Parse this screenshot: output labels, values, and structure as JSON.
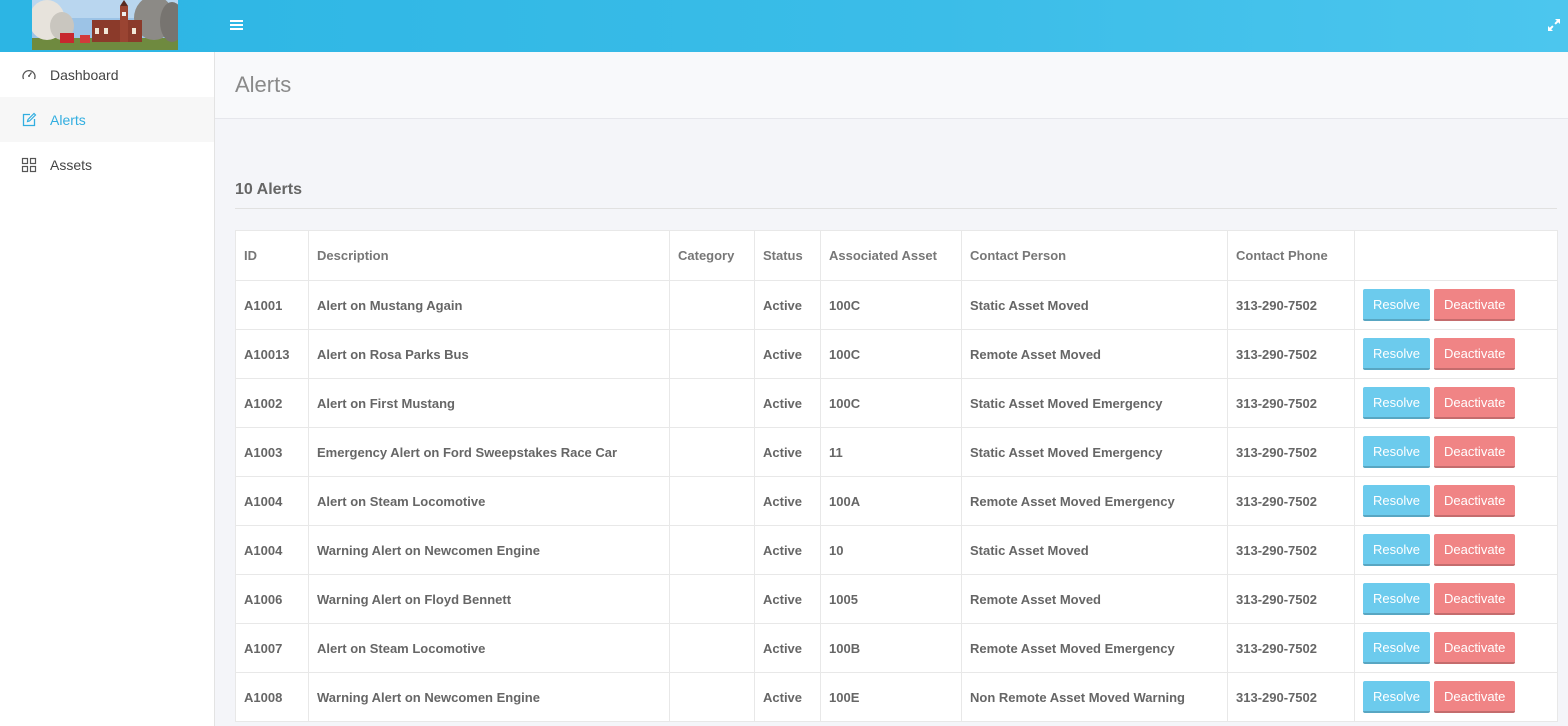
{
  "header": {
    "logo_alt": "Greenfield Village clock tower",
    "menu_icon": "hamburger-icon",
    "expand_icon": "expand-icon"
  },
  "sidebar": {
    "items": [
      {
        "label": "Dashboard",
        "icon": "gauge-icon"
      },
      {
        "label": "Alerts",
        "icon": "edit-icon",
        "active": true
      },
      {
        "label": "Assets",
        "icon": "grid-icon"
      }
    ]
  },
  "page": {
    "title": "Alerts",
    "section_title": "10 Alerts"
  },
  "table": {
    "columns": [
      "ID",
      "Description",
      "Category",
      "Status",
      "Associated Asset",
      "Contact Person",
      "Contact Phone",
      ""
    ],
    "resolve_label": "Resolve",
    "deactivate_label": "Deactivate",
    "rows": [
      {
        "id": "A1001",
        "description": "Alert on Mustang Again",
        "category": "",
        "status": "Active",
        "asset": "100C",
        "contact": "Static Asset Moved",
        "phone": "313-290-7502"
      },
      {
        "id": "A10013",
        "description": "Alert on Rosa Parks Bus",
        "category": "",
        "status": "Active",
        "asset": "100C",
        "contact": "Remote Asset Moved",
        "phone": "313-290-7502"
      },
      {
        "id": "A1002",
        "description": "Alert on First Mustang",
        "category": "",
        "status": "Active",
        "asset": "100C",
        "contact": "Static Asset Moved Emergency",
        "phone": "313-290-7502"
      },
      {
        "id": "A1003",
        "description": "Emergency Alert on Ford Sweepstakes Race Car",
        "category": "",
        "status": "Active",
        "asset": "11",
        "contact": "Static Asset Moved Emergency",
        "phone": "313-290-7502"
      },
      {
        "id": "A1004",
        "description": "Alert on Steam Locomotive",
        "category": "",
        "status": "Active",
        "asset": "100A",
        "contact": "Remote Asset Moved Emergency",
        "phone": "313-290-7502"
      },
      {
        "id": "A1004",
        "description": "Warning Alert on Newcomen Engine",
        "category": "",
        "status": "Active",
        "asset": "10",
        "contact": "Static Asset Moved",
        "phone": "313-290-7502"
      },
      {
        "id": "A1006",
        "description": "Warning Alert on Floyd Bennett",
        "category": "",
        "status": "Active",
        "asset": "1005",
        "contact": "Remote Asset Moved",
        "phone": "313-290-7502"
      },
      {
        "id": "A1007",
        "description": "Alert on Steam Locomotive",
        "category": "",
        "status": "Active",
        "asset": "100B",
        "contact": "Remote Asset Moved Emergency",
        "phone": "313-290-7502"
      },
      {
        "id": "A1008",
        "description": "Warning Alert on Newcomen Engine",
        "category": "",
        "status": "Active",
        "asset": "100E",
        "contact": "Non Remote Asset Moved Warning",
        "phone": "313-290-7502"
      }
    ]
  }
}
